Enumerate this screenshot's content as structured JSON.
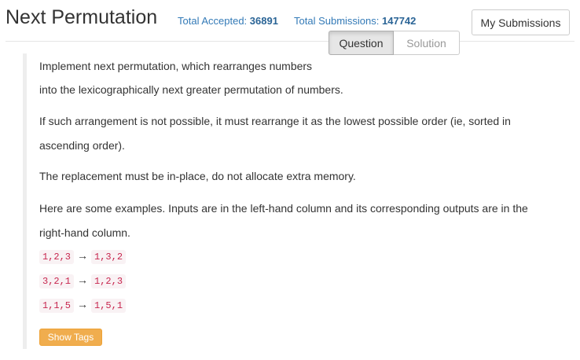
{
  "header": {
    "title": "Next Permutation",
    "accepted_label": "Total Accepted:",
    "accepted_value": "36891",
    "submissions_label": "Total Submissions:",
    "submissions_value": "147742",
    "my_submissions_label": "My Submissions"
  },
  "tabs": [
    {
      "label": "Question",
      "active": true
    },
    {
      "label": "Solution",
      "active": false
    }
  ],
  "content": {
    "line1": "Implement next permutation, which rearranges numbers",
    "line2": "into the lexicographically next greater permutation of numbers.",
    "line3": "If such arrangement is not possible, it must rearrange it as the lowest possible order (ie, sorted in",
    "line4": "ascending order).",
    "line5": "The replacement must be in-place, do not allocate extra memory.",
    "line6": "Here are some examples. Inputs are in the left-hand column and its corresponding outputs are in the",
    "line7": "right-hand column.",
    "examples": [
      {
        "input": "1,2,3",
        "arrow": "→",
        "output": "1,3,2"
      },
      {
        "input": "3,2,1",
        "arrow": "→",
        "output": "1,2,3"
      },
      {
        "input": "1,1,5",
        "arrow": "→",
        "output": "1,5,1"
      }
    ],
    "show_tags_label": "Show Tags"
  },
  "colors": {
    "link": "#337ab7",
    "code_text": "#c7254e",
    "code_bg": "#f9f2f4",
    "warning_button": "#f0ad4e"
  }
}
